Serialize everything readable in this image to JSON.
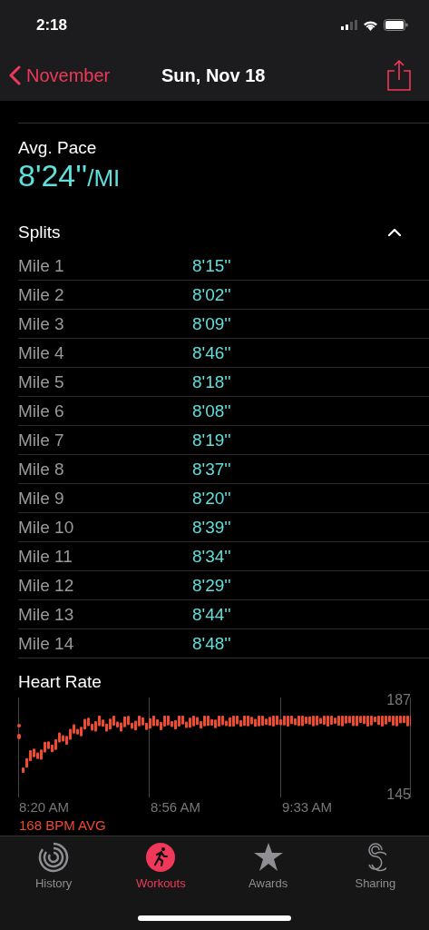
{
  "status_bar": {
    "time": "2:18"
  },
  "nav": {
    "back": "November",
    "title": "Sun, Nov 18"
  },
  "avg_pace": {
    "label": "Avg. Pace",
    "value": "8'24''",
    "unit": "/MI"
  },
  "splits": {
    "title": "Splits",
    "expanded": true,
    "rows": [
      {
        "label": "Mile 1",
        "pace": "8'15''"
      },
      {
        "label": "Mile 2",
        "pace": "8'02''"
      },
      {
        "label": "Mile 3",
        "pace": "8'09''"
      },
      {
        "label": "Mile 4",
        "pace": "8'46''"
      },
      {
        "label": "Mile 5",
        "pace": "8'18''"
      },
      {
        "label": "Mile 6",
        "pace": "8'08''"
      },
      {
        "label": "Mile 7",
        "pace": "8'19''"
      },
      {
        "label": "Mile 8",
        "pace": "8'37''"
      },
      {
        "label": "Mile 9",
        "pace": "8'20''"
      },
      {
        "label": "Mile 10",
        "pace": "8'39''"
      },
      {
        "label": "Mile 11",
        "pace": "8'34''"
      },
      {
        "label": "Mile 12",
        "pace": "8'29''"
      },
      {
        "label": "Mile 13",
        "pace": "8'44''"
      },
      {
        "label": "Mile 14",
        "pace": "8'48''"
      }
    ]
  },
  "heart_rate": {
    "title": "Heart Rate",
    "y_max": "187",
    "y_min": "145",
    "times": [
      "8:20 AM",
      "8:56 AM",
      "9:33 AM"
    ],
    "average": "168 BPM AVG"
  },
  "tabs": [
    {
      "kind": "history",
      "label": "History",
      "selected": false
    },
    {
      "kind": "workouts",
      "label": "Workouts",
      "selected": true
    },
    {
      "kind": "awards",
      "label": "Awards",
      "selected": false
    },
    {
      "kind": "sharing",
      "label": "Sharing",
      "selected": false
    }
  ]
}
